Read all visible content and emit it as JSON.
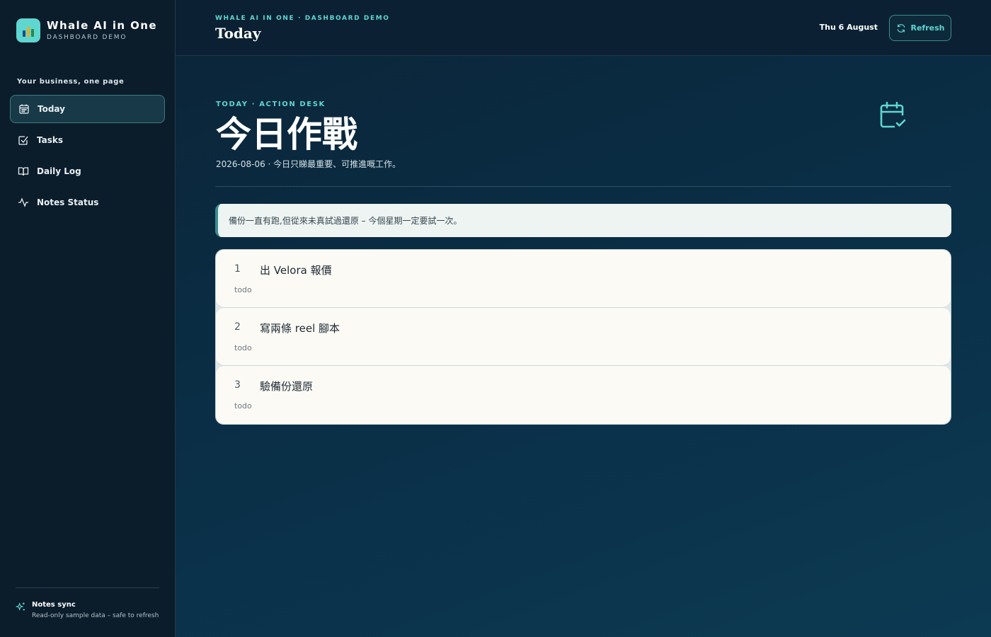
{
  "brand": {
    "title": "Whale AI in One",
    "subtitle": "DASHBOARD DEMO"
  },
  "sidebar": {
    "heading": "Your business, one page",
    "items": [
      {
        "label": "Today",
        "icon": "calendar-icon",
        "active": true
      },
      {
        "label": "Tasks",
        "icon": "checkbox-icon",
        "active": false
      },
      {
        "label": "Daily Log",
        "icon": "book-icon",
        "active": false
      },
      {
        "label": "Notes Status",
        "icon": "activity-icon",
        "active": false
      }
    ],
    "footer": {
      "title": "Notes sync",
      "subtitle": "Read-only sample data – safe to refresh",
      "icon": "sparkle-icon"
    }
  },
  "topbar": {
    "eyebrow": "WHALE AI IN ONE · DASHBOARD DEMO",
    "title": "Today",
    "date": "Thu 6 August",
    "refresh_label": "Refresh"
  },
  "hero": {
    "eyebrow": "TODAY · ACTION DESK",
    "title": "今日作戰",
    "subtitle": "2026-08-06 · 今日只睇最重要、可推進嘅工作。",
    "icon": "calendar-check-icon"
  },
  "note": {
    "text": "備份一直有跑,但從來未真試過還原 – 今個星期一定要試一次。"
  },
  "tasks": [
    {
      "num": "1",
      "title": "出 Velora 報價",
      "status": "todo"
    },
    {
      "num": "2",
      "title": "寫兩條 reel 腳本",
      "status": "todo"
    },
    {
      "num": "3",
      "title": "驗備份還原",
      "status": "todo"
    }
  ],
  "colors": {
    "accent": "#5fd6d0",
    "sidebar_bg": "#0b1c2b",
    "card_bg": "#fbfaf5"
  }
}
